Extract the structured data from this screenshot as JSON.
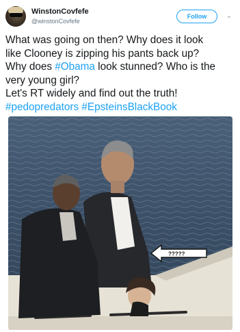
{
  "user": {
    "display_name": "WinstonCovfefe",
    "handle": "@winstonCovfefe"
  },
  "header": {
    "follow_label": "Follow",
    "menu_icon": "chevron-down-icon"
  },
  "tweet": {
    "lines": [
      {
        "parts": [
          {
            "t": "What was going on then? Why does it look",
            "tag": false
          }
        ]
      },
      {
        "parts": [
          {
            "t": "like Clooney is zipping his pants back up?",
            "tag": false
          }
        ]
      },
      {
        "parts": [
          {
            "t": "Why does ",
            "tag": false
          },
          {
            "t": "#Obama",
            "tag": true
          },
          {
            "t": " look stunned? Who is the",
            "tag": false
          }
        ]
      },
      {
        "parts": [
          {
            "t": "very young girl?",
            "tag": false
          }
        ]
      },
      {
        "parts": [
          {
            "t": "Let's RT widely and find out the truth!",
            "tag": false
          }
        ]
      },
      {
        "parts": [
          {
            "t": "#pedopredators",
            "tag": true
          },
          {
            "t": " ",
            "tag": false
          },
          {
            "t": "#EpsteinsBlackBook",
            "tag": true
          }
        ]
      }
    ],
    "hashtag_color": "#1da1f2"
  },
  "photo": {
    "arrow_annotation": "?????"
  },
  "colors": {
    "accent": "#1da1f2",
    "text": "#14171a",
    "muted": "#657786"
  }
}
